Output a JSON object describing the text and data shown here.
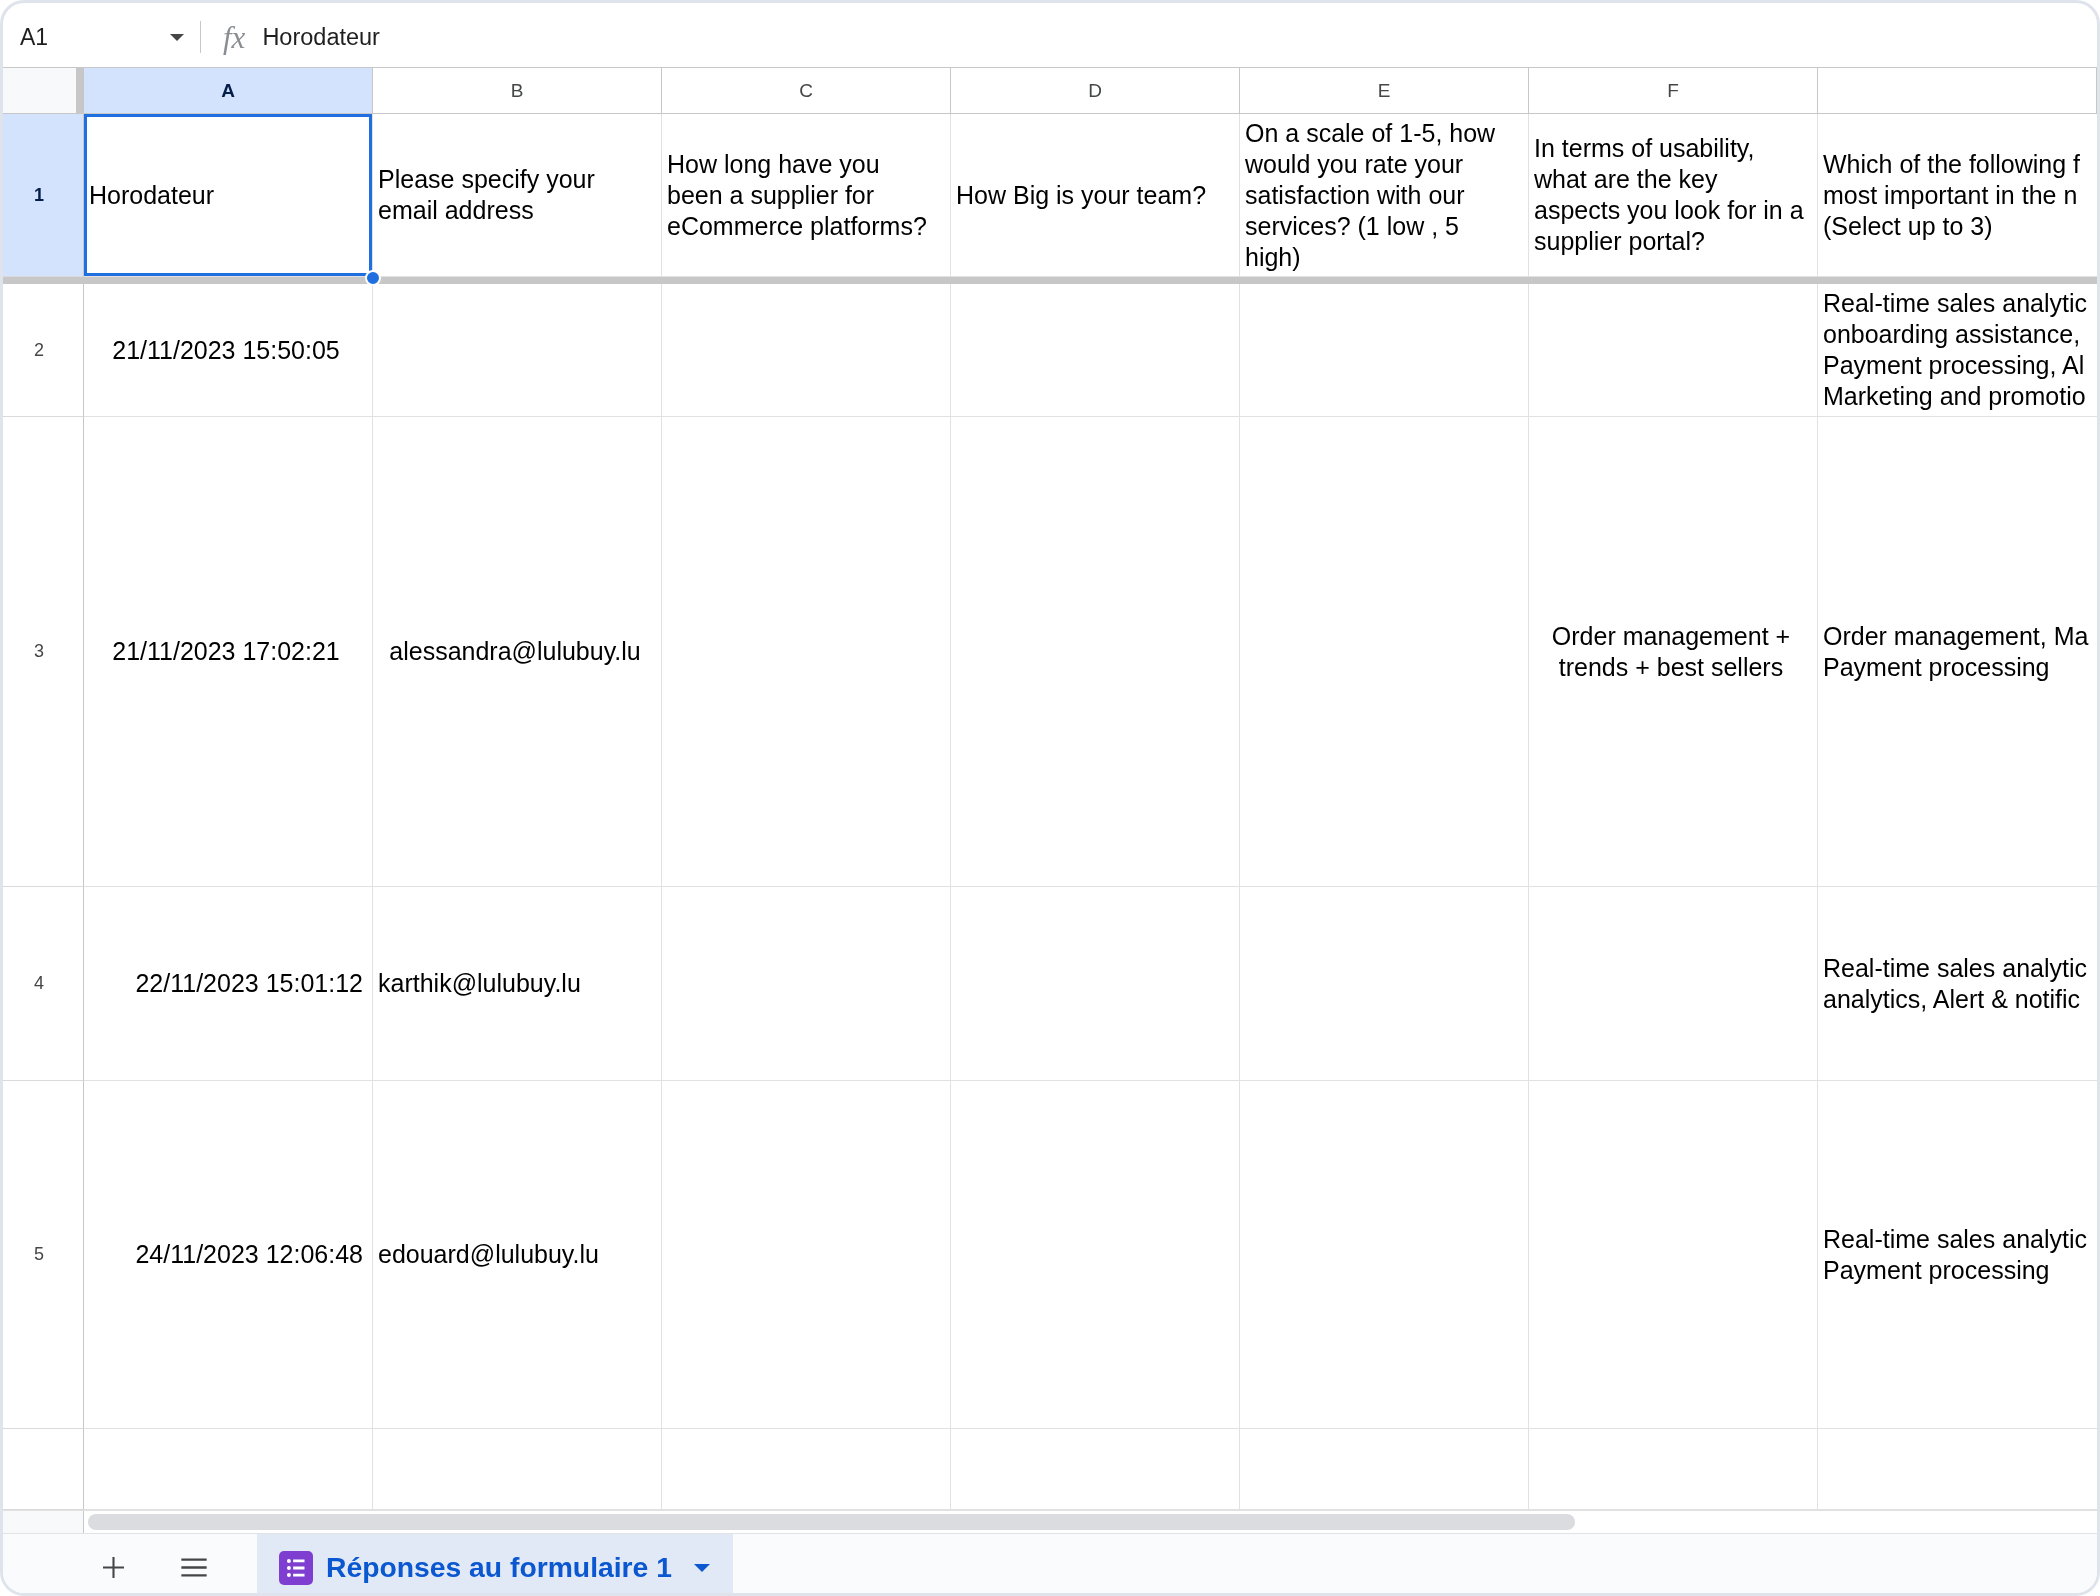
{
  "formula_bar": {
    "name_box": "A1",
    "function_symbol": "fx",
    "formula": "Horodateur"
  },
  "columns": [
    {
      "letter": "A",
      "selected": true
    },
    {
      "letter": "B",
      "selected": false
    },
    {
      "letter": "C",
      "selected": false
    },
    {
      "letter": "D",
      "selected": false
    },
    {
      "letter": "E",
      "selected": false
    },
    {
      "letter": "F",
      "selected": false
    },
    {
      "selected": false
    }
  ],
  "rows": [
    {
      "number": "1",
      "selected": true,
      "cells": [
        {
          "text": "Horodateur",
          "kind": "left"
        },
        {
          "text": "Please specify your email address",
          "kind": "left"
        },
        {
          "text": "How long have you been a supplier for eCommerce platforms?",
          "kind": "left"
        },
        {
          "text": "How Big is your team?",
          "kind": "left"
        },
        {
          "text": "On a scale of 1-5, how would you rate your satisfaction with our services? (1 low , 5 high)",
          "kind": "left"
        },
        {
          "text": "In terms of usability, what are the key aspects you look for in a supplier portal?",
          "kind": "left"
        },
        {
          "text": "Which of the following f\nmost important in the n\n(Select up to 3)",
          "kind": "left"
        }
      ]
    },
    {
      "number": "2",
      "selected": false,
      "cells": [
        {
          "text": "21/11/2023 15:50:05",
          "kind": "center"
        },
        null,
        null,
        null,
        null,
        null,
        {
          "text": "Real-time sales analytic\nonboarding assistance,\nPayment processing, Al\nMarketing and promotio",
          "kind": "left"
        }
      ]
    },
    {
      "number": "3",
      "selected": false,
      "cells": [
        {
          "text": "21/11/2023 17:02:21",
          "kind": "center"
        },
        {
          "text": "alessandra@lulubuy.lu",
          "kind": "center"
        },
        null,
        null,
        null,
        {
          "text": "Order management + trends + best sellers",
          "kind": "center"
        },
        {
          "text": "Order management, Ma\nPayment processing",
          "kind": "left"
        }
      ]
    },
    {
      "number": "4",
      "selected": false,
      "cells": [
        {
          "text": "22/11/2023 15:01:12",
          "kind": "right"
        },
        {
          "text": "karthik@lulubuy.lu",
          "kind": "left"
        },
        null,
        null,
        null,
        null,
        {
          "text": "Real-time sales analytic\nanalytics, Alert & notific",
          "kind": "left"
        }
      ]
    },
    {
      "number": "5",
      "selected": false,
      "cells": [
        {
          "text": "24/11/2023 12:06:48",
          "kind": "right"
        },
        {
          "text": "edouard@lulubuy.lu",
          "kind": "left"
        },
        null,
        null,
        null,
        null,
        {
          "text": "Real-time sales analytic\nPayment processing",
          "kind": "left"
        }
      ]
    },
    {
      "selected": false
    }
  ],
  "sheet_tabs": [
    {
      "label": "Réponses au formulaire 1",
      "selected": true
    }
  ]
}
